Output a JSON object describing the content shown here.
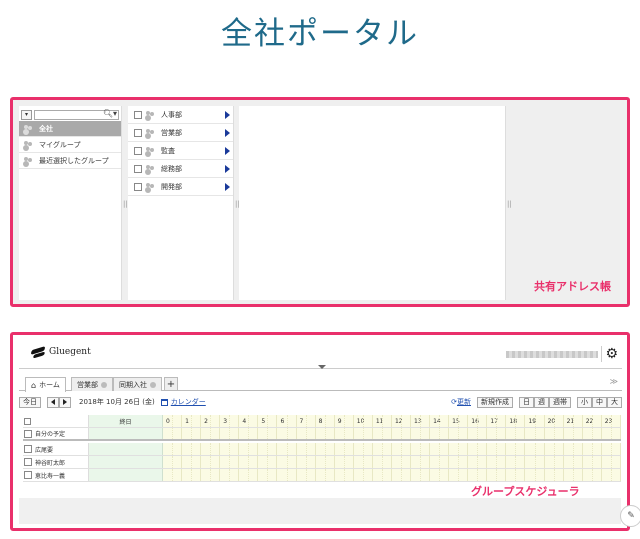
{
  "page": {
    "title": "全社ポータル"
  },
  "address_book": {
    "label": "共有アドレス帳",
    "groups": [
      {
        "label": "全社",
        "selected": true
      },
      {
        "label": "マイグループ",
        "selected": false
      },
      {
        "label": "最近選択したグループ",
        "selected": false
      }
    ],
    "departments": [
      "人事部",
      "営業部",
      "監査",
      "総務部",
      "開発部"
    ]
  },
  "scheduler": {
    "label": "グループスケジューラ",
    "brand": "Gluegent",
    "tabs": [
      {
        "label": "ホーム",
        "active": true
      },
      {
        "label": "営業部",
        "active": false
      },
      {
        "label": "同期入社",
        "active": false
      }
    ],
    "toolbar": {
      "today": "今日",
      "date": "2018年 10月 26日 (金)",
      "calendar": "カレンダー",
      "refresh": "更新",
      "new": "新規作成",
      "views": [
        "日",
        "週",
        "週帯"
      ],
      "sizes": [
        "小",
        "中",
        "大"
      ]
    },
    "grid": {
      "all_day_label": "終日",
      "hours": [
        "0",
        "1",
        "2",
        "3",
        "4",
        "5",
        "6",
        "7",
        "8",
        "9",
        "10",
        "11",
        "12",
        "13",
        "14",
        "15",
        "16",
        "17",
        "18",
        "19",
        "20",
        "21",
        "22",
        "23"
      ],
      "own_row": "自分の予定",
      "members": [
        "広尾要",
        "神谷町太郎",
        "恵比寿一義"
      ]
    }
  }
}
